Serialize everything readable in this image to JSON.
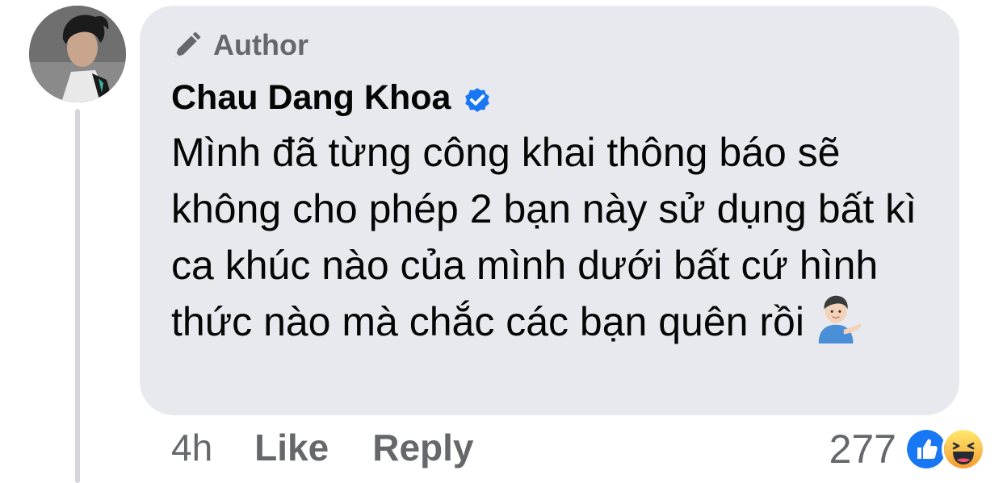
{
  "comment": {
    "badge": {
      "label": "Author",
      "icon": "pen-icon"
    },
    "author_name": "Chau Dang Khoa",
    "verified_icon": "verified-badge-icon",
    "text": "Mình đã từng công khai thông báo sẽ không cho phép 2 bạn này sử dụng bất kì ca khúc nào của mình dưới bất cứ hình thức nào mà chắc các bạn quên rồi",
    "emoji": "person-tipping-hand-emoji"
  },
  "actions": {
    "time": "4h",
    "like_label": "Like",
    "reply_label": "Reply"
  },
  "reactions": {
    "count": "277",
    "icons": [
      "like-reaction-icon",
      "haha-reaction-icon"
    ]
  },
  "colors": {
    "bubble_bg": "#e8e9ee",
    "muted_text": "#65676b",
    "text": "#050505",
    "verified_blue": "#1877f2",
    "thread_line": "#d6d7db"
  }
}
